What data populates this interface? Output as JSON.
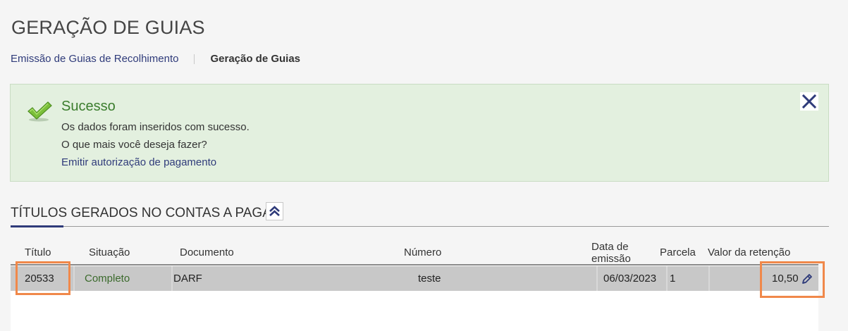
{
  "page": {
    "title": "GERAÇÃO DE GUIAS"
  },
  "breadcrumb": {
    "link": "Emissão de Guias de Recolhimento",
    "current": "Geração de Guias"
  },
  "alert": {
    "title": "Sucesso",
    "message": "Os dados foram inseridos com sucesso.",
    "question": "O que mais você deseja fazer?",
    "action_link": "Emitir autorização de pagamento",
    "icon": "checkmark-icon",
    "close_icon": "close-icon",
    "colors": {
      "background": "#e3f0df",
      "title": "#3b7d2d"
    }
  },
  "section": {
    "title": "TÍTULOS GERADOS NO CONTAS A PAGAR",
    "toggle_icon": "double-chevron-up-icon"
  },
  "table": {
    "headers": {
      "titulo": "Título",
      "situacao": "Situação",
      "documento": "Documento",
      "numero": "Número",
      "data_emissao_1": "Data de",
      "data_emissao_2": "emissão",
      "parcela": "Parcela",
      "valor_retencao": "Valor da retenção"
    },
    "rows": [
      {
        "titulo": "20533",
        "situacao": "Completo",
        "documento": "DARF",
        "numero": "teste",
        "data_emissao": "06/03/2023",
        "parcela": "1",
        "valor_retencao": "10,50",
        "action_icon": "pencil-edit-icon"
      }
    ]
  },
  "colors": {
    "accent": "#2f3b7a",
    "highlight": "#f0884a",
    "row_selected": "#c8c8c8"
  }
}
